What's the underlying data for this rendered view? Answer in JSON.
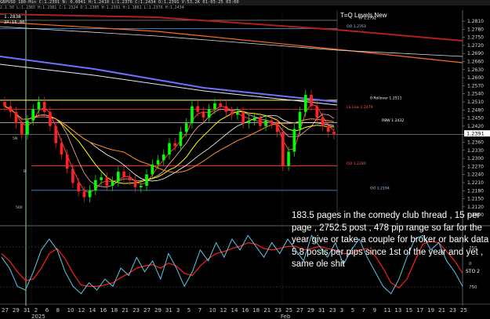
{
  "header": {
    "info_line": "GBPUSD 180-Min C:1.2391 N: 0.0041 H:1.2410 L:1.2376 C:1.2434 O:1.2391 V:53.2K 01-03-25 03:00",
    "sub_line": "2.1.50  L:1.2365 H:1.2381 C:1.2324 O:1.2385 H:1.2391 H:1.1861 L:1.2376 H:1.2434"
  },
  "panel_title": "T=Q Levels New",
  "cursor_label": "1.2838",
  "cursor_sub": "2X:16:00",
  "current_price": "1.2391",
  "price_axis": [
    "1.2810",
    "1.2780",
    "1.2750",
    "1.2720",
    "1.2690",
    "1.2660",
    "1.2630",
    "1.2600",
    "1.2570",
    "1.2540",
    "1.2510",
    "1.2480",
    "1.2450",
    "1.2420",
    "1.2391",
    "1.2360",
    "1.2330",
    "1.2300",
    "1.2270",
    "1.2240",
    "1.2210",
    "1.2180",
    "1.2150",
    "1.2120",
    "1.2090"
  ],
  "level_labels": [
    {
      "text": "YP 1.2792",
      "color": "#ffffff"
    },
    {
      "text": "OO 1.2763",
      "color": "#9ec9ff"
    },
    {
      "text": "0 Rollover 1.2511",
      "color": "#ffffff"
    },
    {
      "text": "LS Low 1.2479",
      "color": "#ff5555"
    },
    {
      "text": "RBW 1.2432",
      "color": "#ffffff"
    },
    {
      "text": "OO 1.2280",
      "color": "#ff5555"
    },
    {
      "text": "OO 1.2194",
      "color": "#9ec9ff"
    }
  ],
  "left_markers": [
    "5N",
    "B",
    "500"
  ],
  "sto_axis": [
    "250",
    "0",
    "STO 2",
    "750"
  ],
  "time_axis": [
    "27",
    "29",
    "31",
    "2",
    "6",
    "8",
    "10",
    "12",
    "14",
    "16",
    "18",
    "21",
    "23",
    "27",
    "29",
    "31",
    "3",
    "5",
    "7",
    "10",
    "12",
    "14",
    "16",
    "18",
    "21",
    "23",
    "25",
    "27",
    "29",
    "31",
    "23",
    "3",
    "5",
    "7",
    "9",
    "11",
    "13",
    "15",
    "17",
    "19",
    "21",
    "23",
    "25"
  ],
  "time_axis_sub": [
    "2025",
    "Feb"
  ],
  "note_text": "183.5 pages in the comedy club thread , 15 per page , 2752.5 post , 478 pip range so far for the year give or take a couple for broker or bank data 5.8 posts per pips since 1st of the year and yet , same ole shit",
  "colors": {
    "background": "#000000",
    "candle_up": "#00ff00",
    "candle_down": "#ff2222",
    "ma_fast": "#ff4444",
    "ma_slow": "#ffff00",
    "ma_long": "#7070ff",
    "stoch_k": "#5bc8e8",
    "stoch_d": "#ff2020",
    "yellow_level": "#ffff66",
    "red_level": "#ff3333",
    "blue_level": "#4aa0ff"
  },
  "chart_data": {
    "type": "candlestick",
    "title": "",
    "xlabel": "",
    "ylabel": "",
    "ylim": [
      1.2075,
      1.2825
    ],
    "levels": [
      {
        "label": "YP",
        "value": 1.2792
      },
      {
        "label": "OO",
        "value": 1.2763
      },
      {
        "label": "0 Rollover",
        "value": 1.2511
      },
      {
        "label": "LS Low",
        "value": 1.2479
      },
      {
        "label": "RBW",
        "value": 1.2432
      },
      {
        "label": "OO",
        "value": 1.228
      },
      {
        "label": "OO",
        "value": 1.2194
      }
    ],
    "closes": [
      1.249,
      1.247,
      1.243,
      1.239,
      1.244,
      1.248,
      1.2505,
      1.247,
      1.242,
      1.236,
      1.232,
      1.227,
      1.222,
      1.219,
      1.217,
      1.2195,
      1.223,
      1.224,
      1.221,
      1.2225,
      1.226,
      1.224,
      1.223,
      1.2205,
      1.221,
      1.225,
      1.2285,
      1.23,
      1.232,
      1.236,
      1.235,
      1.24,
      1.243,
      1.249,
      1.247,
      1.245,
      1.248,
      1.25,
      1.249,
      1.247,
      1.246,
      1.247,
      1.243,
      1.244,
      1.245,
      1.242,
      1.244,
      1.243,
      1.24,
      1.228,
      1.233,
      1.241,
      1.247,
      1.253,
      1.249,
      1.245,
      1.242,
      1.24,
      1.2391
    ],
    "stoch_k": [
      60,
      45,
      20,
      15,
      40,
      70,
      85,
      70,
      40,
      20,
      10,
      25,
      15,
      30,
      20,
      45,
      35,
      60,
      40,
      55,
      30,
      65,
      45,
      20,
      40,
      70,
      55,
      80,
      60,
      85,
      70,
      90,
      75,
      60,
      80,
      65,
      85,
      70,
      55,
      90,
      75,
      60,
      80,
      50,
      70,
      85,
      60,
      40,
      20,
      10,
      30,
      60,
      85,
      90,
      70,
      80,
      55,
      40,
      20
    ],
    "stoch_d": [
      65,
      55,
      40,
      28,
      30,
      45,
      65,
      72,
      58,
      38,
      22,
      20,
      20,
      22,
      25,
      32,
      38,
      45,
      48,
      50,
      45,
      52,
      48,
      38,
      35,
      48,
      58,
      65,
      68,
      72,
      75,
      80,
      78,
      72,
      70,
      72,
      75,
      75,
      70,
      72,
      75,
      72,
      70,
      65,
      65,
      70,
      72,
      62,
      45,
      25,
      18,
      30,
      55,
      78,
      82,
      80,
      68,
      55,
      38
    ]
  }
}
